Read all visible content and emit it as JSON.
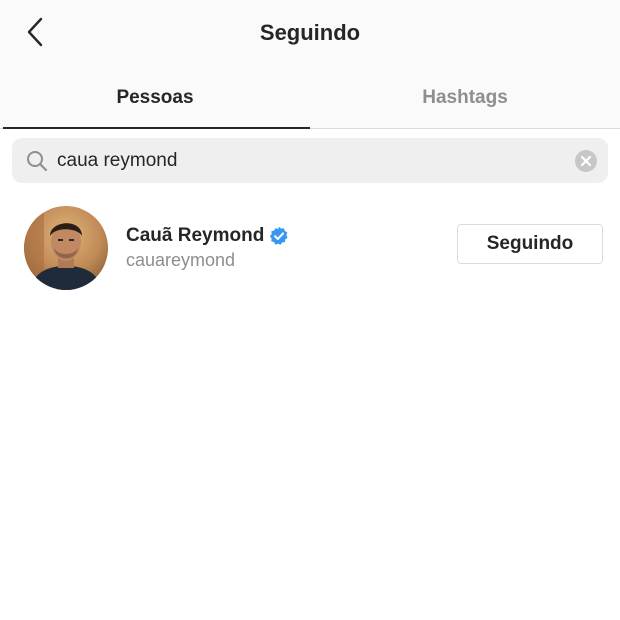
{
  "header": {
    "title": "Seguindo",
    "back_icon": "chevron-left-icon"
  },
  "tabs": [
    {
      "label": "Pessoas",
      "active": true
    },
    {
      "label": "Hashtags",
      "active": false
    }
  ],
  "search": {
    "value": "caua reymond",
    "icon": "search-icon",
    "clear_icon": "clear-icon"
  },
  "results": [
    {
      "name": "Cauã Reymond",
      "username": "cauareymond",
      "verified": true,
      "button_label": "Seguindo"
    }
  ],
  "colors": {
    "verified_blue": "#3897f0",
    "muted_text": "#8e8e8e",
    "primary_text": "#262626"
  }
}
